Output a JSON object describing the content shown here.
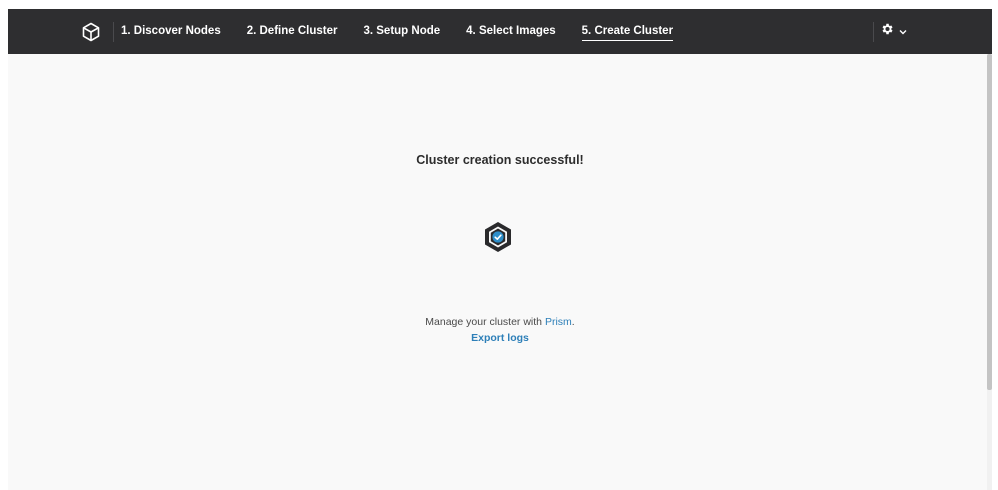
{
  "navbar": {
    "logo_icon": "nutanix-cube-icon",
    "steps": [
      {
        "label": "1. Discover Nodes"
      },
      {
        "label": "2. Define Cluster"
      },
      {
        "label": "3. Setup Node"
      },
      {
        "label": "4. Select Images"
      },
      {
        "label": "5. Create Cluster",
        "active": true
      }
    ],
    "settings_icon": "gear-icon",
    "settings_chevron_icon": "chevron-down-icon"
  },
  "main": {
    "title": "Cluster creation successful!",
    "status_icon": "cluster-success-icon",
    "manage_prefix": "Manage your cluster with ",
    "manage_link": "Prism",
    "manage_suffix": ".",
    "export_link": "Export logs"
  },
  "colors": {
    "navbar_bg": "#2e2e30",
    "page_bg": "#f9f9f9",
    "link": "#2d7fb8",
    "icon_accent": "#2d8ec9",
    "icon_dark": "#2a2a2c"
  }
}
